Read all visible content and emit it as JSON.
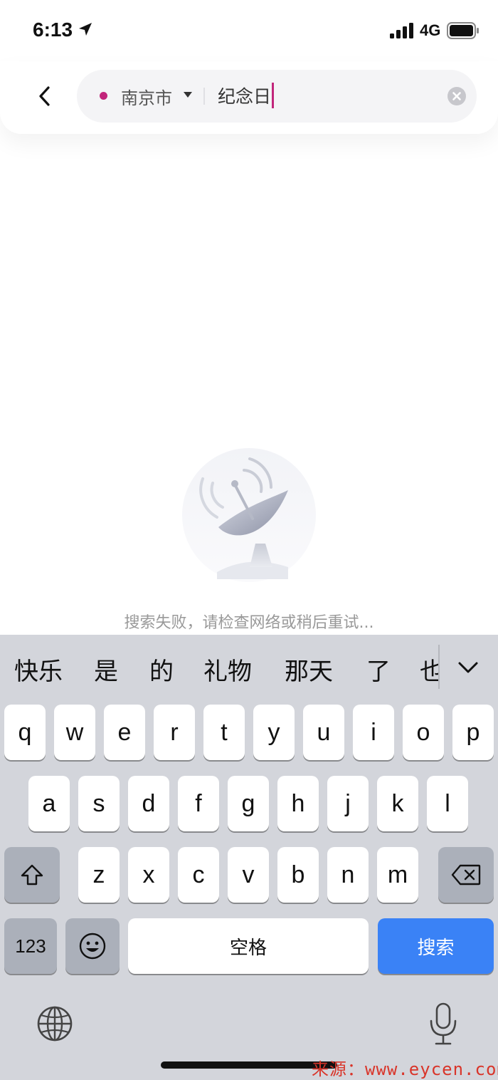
{
  "status_bar": {
    "time": "6:13",
    "network": "4G"
  },
  "search": {
    "city": "南京市",
    "query": "纪念日",
    "accent_color": "#c2257b"
  },
  "empty_state": {
    "message": "搜索失败，请检查网络或稍后重试..."
  },
  "keyboard": {
    "candidates": [
      "快乐",
      "是",
      "的",
      "礼物",
      "那天",
      "了",
      "也"
    ],
    "row1": [
      "q",
      "w",
      "e",
      "r",
      "t",
      "y",
      "u",
      "i",
      "o",
      "p"
    ],
    "row2": [
      "a",
      "s",
      "d",
      "f",
      "g",
      "h",
      "j",
      "k",
      "l"
    ],
    "row3": [
      "z",
      "x",
      "c",
      "v",
      "b",
      "n",
      "m"
    ],
    "numbers_label": "123",
    "space_label": "空格",
    "search_label": "搜索",
    "search_key_color": "#3a82f6"
  },
  "watermark": "来源：www.eycen.com"
}
